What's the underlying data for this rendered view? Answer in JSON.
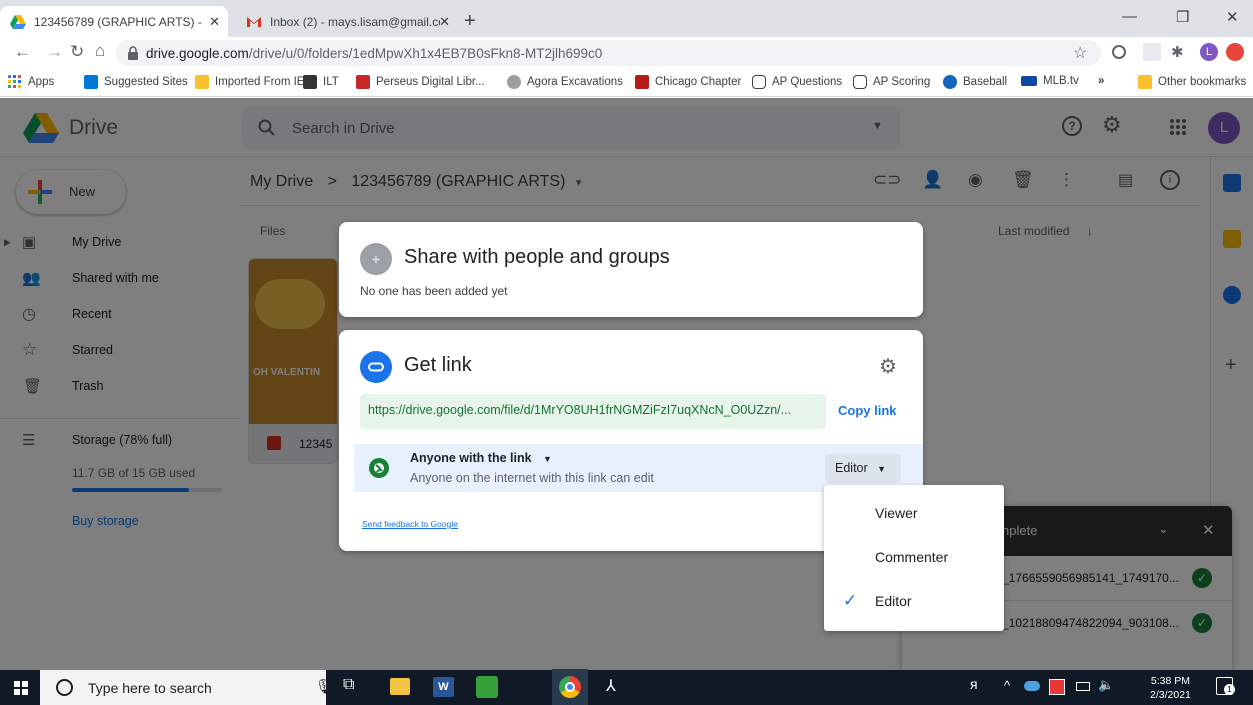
{
  "browser": {
    "tabs": [
      {
        "title": "123456789 (GRAPHIC ARTS) - Go",
        "active": true
      },
      {
        "title": "Inbox (2) - mays.lisam@gmail.co",
        "active": false
      }
    ],
    "url_domain": "drive.google.com",
    "url_path": "/drive/u/0/folders/1edMpwXh1x4EB7B0sFkn8-MT2jlh699c0",
    "bookmarks": [
      {
        "label": "Apps"
      },
      {
        "label": "Suggested Sites"
      },
      {
        "label": "Imported From IE"
      },
      {
        "label": "ILT"
      },
      {
        "label": "Perseus Digital Libr..."
      },
      {
        "label": "Agora Excavations"
      },
      {
        "label": "Chicago Chapter"
      },
      {
        "label": "AP Questions"
      },
      {
        "label": "AP Scoring"
      },
      {
        "label": "Baseball"
      },
      {
        "label": "MLB.tv"
      },
      {
        "label": "Other bookmarks"
      }
    ],
    "more_bookmarks": "»",
    "profile_initial": "L"
  },
  "drive": {
    "app_name": "Drive",
    "search_placeholder": "Search in Drive",
    "avatar_initial": "L",
    "new_label": "New",
    "breadcrumb": {
      "root": "My Drive",
      "sep": ">",
      "current": "123456789 (GRAPHIC ARTS)"
    },
    "sidebar": {
      "items": [
        {
          "label": "My Drive"
        },
        {
          "label": "Shared with me"
        },
        {
          "label": "Recent"
        },
        {
          "label": "Starred"
        },
        {
          "label": "Trash"
        }
      ],
      "storage_label": "Storage (78% full)",
      "storage_used": "11.7 GB of 15 GB used",
      "storage_fraction": 0.78,
      "buy_storage": "Buy storage"
    },
    "files_header": "Files",
    "sort_label": "Last modified",
    "file_name_partial": "12345",
    "thumb_text": "OH VALENTIN",
    "upload_panel": {
      "title_partial": "nplete",
      "items": [
        "_1766559056985141_1749170...",
        "_10218809474822094_903108..."
      ]
    }
  },
  "share_dialog": {
    "title": "Share with people and groups",
    "subtitle": "No one has been added yet"
  },
  "link_dialog": {
    "title": "Get link",
    "url": "https://drive.google.com/file/d/1MrYO8UH1frNGMZiFzI7uqXNcN_O0UZzn/...",
    "copy_label": "Copy link",
    "access_scope": "Anyone with the link",
    "access_desc": "Anyone on the internet with this link can edit",
    "role": "Editor",
    "feedback": "Send feedback to Google"
  },
  "role_menu": {
    "options": [
      "Viewer",
      "Commenter",
      "Editor"
    ],
    "selected": "Editor"
  },
  "taskbar": {
    "search_placeholder": "Type here to search",
    "time": "5:38 PM",
    "date": "2/3/2021",
    "notifications": "1"
  },
  "colors": {
    "drive_blue": "#1a73e8",
    "link_green_bg": "#e6f4ea",
    "link_green_text": "#137333",
    "access_bg": "#e8f0fe",
    "overlay": "rgba(0,0,0,0.5)"
  }
}
